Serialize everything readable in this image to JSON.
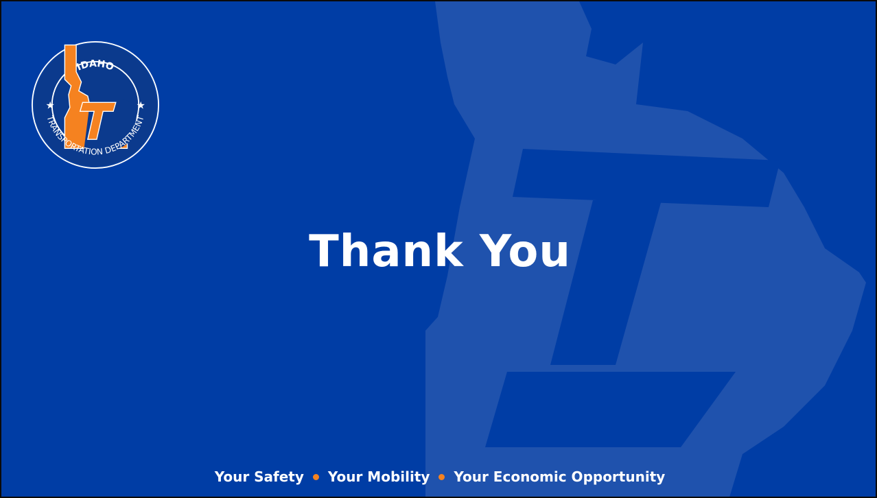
{
  "slide": {
    "title": "Thank You",
    "tagline": {
      "part1": "Your Safety",
      "part2": "Your Mobility",
      "part3": "Your Economic Opportunity"
    }
  },
  "logo": {
    "top_text": "IDAHO",
    "bottom_text": "TRANSPORTATION DEPARTMENT",
    "monogram": "ITD"
  },
  "colors": {
    "background": "#003da5",
    "watermark": "#1f52ad",
    "accent_orange": "#f58220",
    "text": "#ffffff"
  }
}
